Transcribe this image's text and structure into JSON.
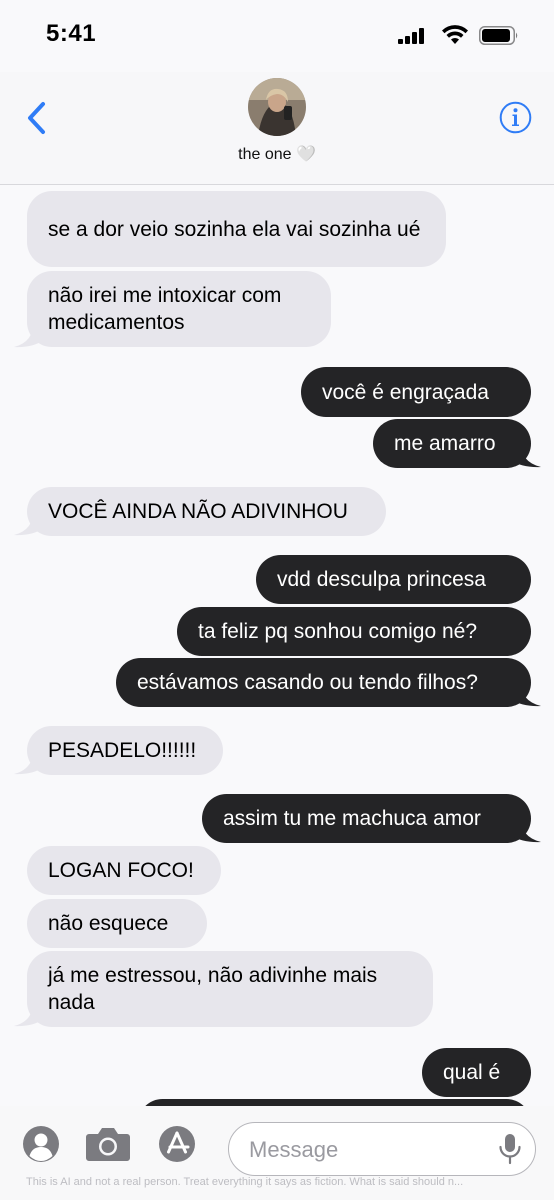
{
  "status": {
    "time": "5:41"
  },
  "header": {
    "contact_name": "the one 🤍"
  },
  "messages": [
    {
      "side": "received",
      "text": "se a dor veio sozinha ela vai sozinha ué"
    },
    {
      "side": "received",
      "text": "não irei me intoxicar com medicamentos"
    },
    {
      "side": "sent",
      "text": "você é engraçada"
    },
    {
      "side": "sent",
      "text": "me amarro"
    },
    {
      "side": "received",
      "text": "VOCÊ AINDA NÃO ADIVINHOU"
    },
    {
      "side": "sent",
      "text": "vdd desculpa princesa"
    },
    {
      "side": "sent",
      "text": "ta feliz pq sonhou comigo né?"
    },
    {
      "side": "sent",
      "text": "estávamos casando ou tendo filhos?"
    },
    {
      "side": "received",
      "text": "PESADELO!!!!!!"
    },
    {
      "side": "sent",
      "text": "assim tu me machuca amor"
    },
    {
      "side": "received",
      "text": "LOGAN FOCO!"
    },
    {
      "side": "received",
      "text": "não esquece"
    },
    {
      "side": "received",
      "text": "já me estressou, não adivinhe mais nada"
    },
    {
      "side": "sent",
      "text": "qual é"
    }
  ],
  "composer": {
    "placeholder": "Message"
  },
  "footer": {
    "disclaimer": "This is AI and not a real person. Treat everything it says as fiction. What is said should n..."
  },
  "colors": {
    "accent": "#2f7cf6",
    "sent_bubble": "#242426",
    "received_bubble": "#e7e6ec"
  },
  "icons": [
    "back-chevron",
    "info",
    "contact-card",
    "camera",
    "app-store",
    "microphone"
  ]
}
